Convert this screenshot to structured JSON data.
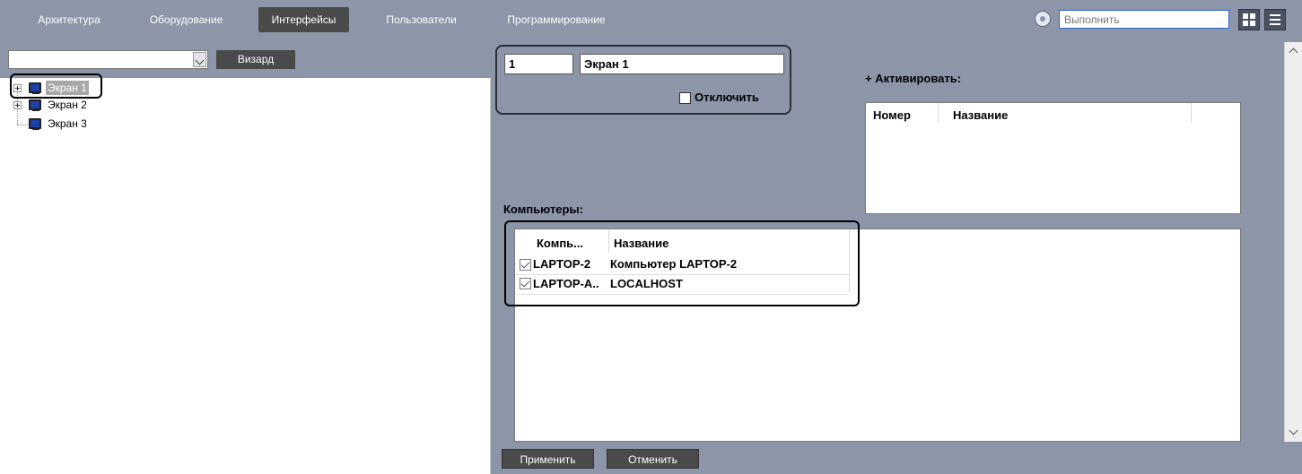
{
  "tabs": [
    "Архитектура",
    "Оборудование",
    "Интерфейсы",
    "Пользователи",
    "Программирование"
  ],
  "active_tab": "Интерфейсы",
  "toolbar": {
    "run_placeholder": "Выполнить",
    "run_icon": "gear-icon",
    "layout_icon": "grid-icon",
    "menu_icon": "menu-icon"
  },
  "left": {
    "wizard_label": "Визард",
    "combo_value": "",
    "tree": [
      {
        "label": "Экран 1",
        "selected": true
      },
      {
        "label": "Экран 2"
      },
      {
        "label": "Экран 3"
      }
    ]
  },
  "screen": {
    "number": "1",
    "name": "Экран 1",
    "disable_label": "Отключить",
    "disable_checked": false
  },
  "activate": {
    "label": "+ Активировать:",
    "columns": [
      "Номер",
      "Название"
    ]
  },
  "computers": {
    "label": "Компьютеры:",
    "columns": [
      "Компь...",
      "Название"
    ],
    "rows": [
      {
        "checked": true,
        "id": "LAPTOP-2",
        "name": "Компьютер LAPTOP-2"
      },
      {
        "checked": true,
        "id": "LAPTOP-A..",
        "name": "LOCALHOST"
      }
    ]
  },
  "buttons": {
    "apply": "Применить",
    "cancel": "Отменить"
  },
  "colors": {
    "panel": "#8c96a8",
    "active_tab": "#4a4a4a",
    "button": "#4a4a4a",
    "highlight": "#000000"
  }
}
